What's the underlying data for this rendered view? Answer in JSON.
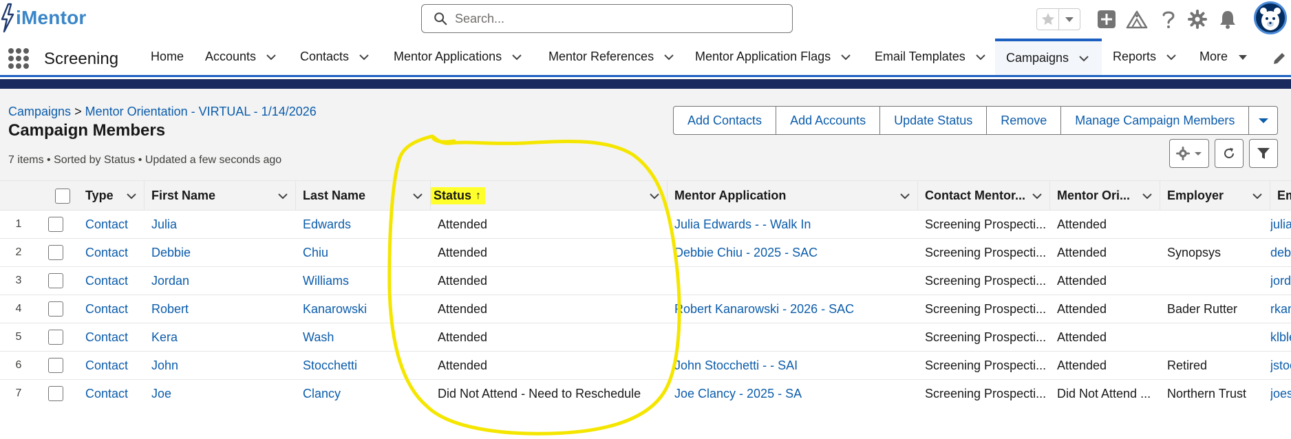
{
  "header": {
    "logo_text": "iMentor",
    "search_placeholder": "Search..."
  },
  "icons": [
    "search-icon",
    "star-icon",
    "chevron-down-icon",
    "add-icon",
    "trailhead-icon",
    "help-icon",
    "gear-icon",
    "bell-icon",
    "avatar",
    "app-launcher-icon",
    "edit-pencil-icon",
    "refresh-icon",
    "filter-icon",
    "sort-asc-icon"
  ],
  "nav": {
    "app_name": "Screening",
    "items": [
      {
        "label": "Home"
      },
      {
        "label": "Accounts"
      },
      {
        "label": "Contacts"
      },
      {
        "label": "Mentor Applications"
      },
      {
        "label": "Mentor References"
      },
      {
        "label": "Mentor Application Flags"
      },
      {
        "label": "Email Templates"
      },
      {
        "label": "Campaigns"
      },
      {
        "label": "Reports"
      },
      {
        "label": "More"
      }
    ]
  },
  "page": {
    "breadcrumb_root": "Campaigns",
    "breadcrumb_sep": ">",
    "breadcrumb_current": "Mentor Orientation - VIRTUAL - 1/14/2026",
    "title": "Campaign Members",
    "meta": "7 items • Sorted by Status • Updated a few seconds ago"
  },
  "actions": {
    "add_contacts": "Add Contacts",
    "add_accounts": "Add Accounts",
    "update_status": "Update Status",
    "remove": "Remove",
    "manage_members": "Manage Campaign Members"
  },
  "table": {
    "columns": {
      "type": "Type",
      "first_name": "First Name",
      "last_name": "Last Name",
      "status": "Status",
      "status_sort": "↑",
      "mentor_application": "Mentor Application",
      "contact_mentor": "Contact Mentor...",
      "mentor_ori": "Mentor Ori...",
      "employer": "Employer",
      "email": "Ema"
    },
    "rows": [
      {
        "n": "1",
        "type": "Contact",
        "first": "Julia",
        "last": "Edwards",
        "status": "Attended",
        "app": "Julia Edwards - - Walk In",
        "contact_mentor": "Screening Prospecti...",
        "mentor_ori": "Attended",
        "employer": "",
        "email": "julia"
      },
      {
        "n": "2",
        "type": "Contact",
        "first": "Debbie",
        "last": "Chiu",
        "status": "Attended",
        "app": "Debbie Chiu - 2025 - SAC",
        "contact_mentor": "Screening Prospecti...",
        "mentor_ori": "Attended",
        "employer": "Synopsys",
        "email": "debb"
      },
      {
        "n": "3",
        "type": "Contact",
        "first": "Jordan",
        "last": "Williams",
        "status": "Attended",
        "app": "",
        "contact_mentor": "Screening Prospecti...",
        "mentor_ori": "Attended",
        "employer": "",
        "email": "jord"
      },
      {
        "n": "4",
        "type": "Contact",
        "first": "Robert",
        "last": "Kanarowski",
        "status": "Attended",
        "app": "Robert Kanarowski - 2026 - SAC",
        "contact_mentor": "Screening Prospecti...",
        "mentor_ori": "Attended",
        "employer": "Bader Rutter",
        "email": "rkan"
      },
      {
        "n": "5",
        "type": "Contact",
        "first": "Kera",
        "last": "Wash",
        "status": "Attended",
        "app": "",
        "contact_mentor": "Screening Prospecti...",
        "mentor_ori": "Attended",
        "employer": "",
        "email": "klble"
      },
      {
        "n": "6",
        "type": "Contact",
        "first": "John",
        "last": "Stocchetti",
        "status": "Attended",
        "app": "John Stocchetti - - SAI",
        "contact_mentor": "Screening Prospecti...",
        "mentor_ori": "Attended",
        "employer": "Retired",
        "email": "jstoc"
      },
      {
        "n": "7",
        "type": "Contact",
        "first": "Joe",
        "last": "Clancy",
        "status": "Did Not Attend - Need to Reschedule",
        "app": "Joe Clancy - 2025 - SA",
        "contact_mentor": "Screening Prospecti...",
        "mentor_ori": "Did Not Attend ...",
        "employer": "Northern Trust",
        "email": "joes"
      }
    ]
  },
  "colors": {
    "brand": "#3a86c8",
    "link": "#0b5cab",
    "nav_accent": "#1b5fc1",
    "band": "#1b2a5e",
    "highlight": "#ffff2b",
    "annotation": "#f5e600"
  }
}
